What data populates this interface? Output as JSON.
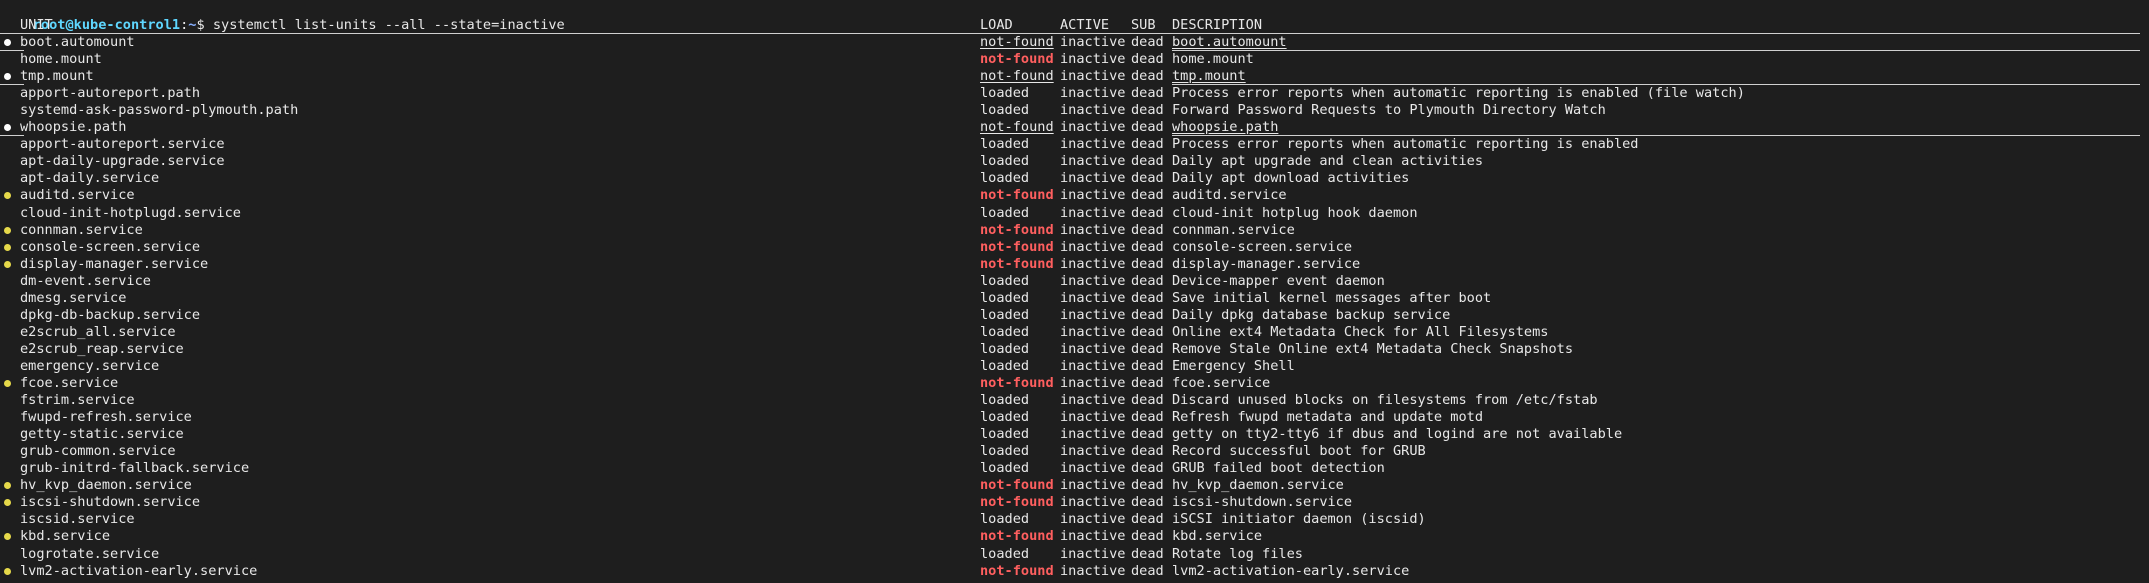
{
  "prompt": {
    "user_host": "root@kube-control1",
    "path": "~",
    "symbol": "$",
    "command": "systemctl list-units --all --state=inactive"
  },
  "header": {
    "unit": "UNIT",
    "load": "LOAD",
    "active": "ACTIVE",
    "sub": "SUB",
    "description": "DESCRIPTION"
  },
  "rows": [
    {
      "bullet": "white",
      "unit": "boot.automount",
      "load": "not-found",
      "active": "inactive",
      "sub": "dead",
      "desc": "boot.automount",
      "style": "ul"
    },
    {
      "bullet": "",
      "unit": "home.mount",
      "load": "not-found",
      "active": "inactive",
      "sub": "dead",
      "desc": "home.mount",
      "style": "red"
    },
    {
      "bullet": "white",
      "unit": "tmp.mount",
      "load": "not-found",
      "active": "inactive",
      "sub": "dead",
      "desc": "tmp.mount",
      "style": "ul"
    },
    {
      "bullet": "",
      "unit": "apport-autoreport.path",
      "load": "loaded",
      "active": "inactive",
      "sub": "dead",
      "desc": "Process error reports when automatic reporting is enabled (file watch)",
      "style": ""
    },
    {
      "bullet": "",
      "unit": "systemd-ask-password-plymouth.path",
      "load": "loaded",
      "active": "inactive",
      "sub": "dead",
      "desc": "Forward Password Requests to Plymouth Directory Watch",
      "style": ""
    },
    {
      "bullet": "white",
      "unit": "whoopsie.path",
      "load": "not-found",
      "active": "inactive",
      "sub": "dead",
      "desc": "whoopsie.path",
      "style": "ul"
    },
    {
      "bullet": "",
      "unit": "apport-autoreport.service",
      "load": "loaded",
      "active": "inactive",
      "sub": "dead",
      "desc": "Process error reports when automatic reporting is enabled",
      "style": ""
    },
    {
      "bullet": "",
      "unit": "apt-daily-upgrade.service",
      "load": "loaded",
      "active": "inactive",
      "sub": "dead",
      "desc": "Daily apt upgrade and clean activities",
      "style": ""
    },
    {
      "bullet": "",
      "unit": "apt-daily.service",
      "load": "loaded",
      "active": "inactive",
      "sub": "dead",
      "desc": "Daily apt download activities",
      "style": ""
    },
    {
      "bullet": "yellow",
      "unit": "auditd.service",
      "load": "not-found",
      "active": "inactive",
      "sub": "dead",
      "desc": "auditd.service",
      "style": "red"
    },
    {
      "bullet": "",
      "unit": "cloud-init-hotplugd.service",
      "load": "loaded",
      "active": "inactive",
      "sub": "dead",
      "desc": "cloud-init hotplug hook daemon",
      "style": ""
    },
    {
      "bullet": "yellow",
      "unit": "connman.service",
      "load": "not-found",
      "active": "inactive",
      "sub": "dead",
      "desc": "connman.service",
      "style": "red"
    },
    {
      "bullet": "yellow",
      "unit": "console-screen.service",
      "load": "not-found",
      "active": "inactive",
      "sub": "dead",
      "desc": "console-screen.service",
      "style": "red"
    },
    {
      "bullet": "yellow",
      "unit": "display-manager.service",
      "load": "not-found",
      "active": "inactive",
      "sub": "dead",
      "desc": "display-manager.service",
      "style": "red"
    },
    {
      "bullet": "",
      "unit": "dm-event.service",
      "load": "loaded",
      "active": "inactive",
      "sub": "dead",
      "desc": "Device-mapper event daemon",
      "style": ""
    },
    {
      "bullet": "",
      "unit": "dmesg.service",
      "load": "loaded",
      "active": "inactive",
      "sub": "dead",
      "desc": "Save initial kernel messages after boot",
      "style": ""
    },
    {
      "bullet": "",
      "unit": "dpkg-db-backup.service",
      "load": "loaded",
      "active": "inactive",
      "sub": "dead",
      "desc": "Daily dpkg database backup service",
      "style": ""
    },
    {
      "bullet": "",
      "unit": "e2scrub_all.service",
      "load": "loaded",
      "active": "inactive",
      "sub": "dead",
      "desc": "Online ext4 Metadata Check for All Filesystems",
      "style": ""
    },
    {
      "bullet": "",
      "unit": "e2scrub_reap.service",
      "load": "loaded",
      "active": "inactive",
      "sub": "dead",
      "desc": "Remove Stale Online ext4 Metadata Check Snapshots",
      "style": ""
    },
    {
      "bullet": "",
      "unit": "emergency.service",
      "load": "loaded",
      "active": "inactive",
      "sub": "dead",
      "desc": "Emergency Shell",
      "style": ""
    },
    {
      "bullet": "yellow",
      "unit": "fcoe.service",
      "load": "not-found",
      "active": "inactive",
      "sub": "dead",
      "desc": "fcoe.service",
      "style": "red"
    },
    {
      "bullet": "",
      "unit": "fstrim.service",
      "load": "loaded",
      "active": "inactive",
      "sub": "dead",
      "desc": "Discard unused blocks on filesystems from /etc/fstab",
      "style": ""
    },
    {
      "bullet": "",
      "unit": "fwupd-refresh.service",
      "load": "loaded",
      "active": "inactive",
      "sub": "dead",
      "desc": "Refresh fwupd metadata and update motd",
      "style": ""
    },
    {
      "bullet": "",
      "unit": "getty-static.service",
      "load": "loaded",
      "active": "inactive",
      "sub": "dead",
      "desc": "getty on tty2-tty6 if dbus and logind are not available",
      "style": ""
    },
    {
      "bullet": "",
      "unit": "grub-common.service",
      "load": "loaded",
      "active": "inactive",
      "sub": "dead",
      "desc": "Record successful boot for GRUB",
      "style": ""
    },
    {
      "bullet": "",
      "unit": "grub-initrd-fallback.service",
      "load": "loaded",
      "active": "inactive",
      "sub": "dead",
      "desc": "GRUB failed boot detection",
      "style": ""
    },
    {
      "bullet": "yellow",
      "unit": "hv_kvp_daemon.service",
      "load": "not-found",
      "active": "inactive",
      "sub": "dead",
      "desc": "hv_kvp_daemon.service",
      "style": "red"
    },
    {
      "bullet": "yellow",
      "unit": "iscsi-shutdown.service",
      "load": "not-found",
      "active": "inactive",
      "sub": "dead",
      "desc": "iscsi-shutdown.service",
      "style": "red"
    },
    {
      "bullet": "",
      "unit": "iscsid.service",
      "load": "loaded",
      "active": "inactive",
      "sub": "dead",
      "desc": "iSCSI initiator daemon (iscsid)",
      "style": ""
    },
    {
      "bullet": "yellow",
      "unit": "kbd.service",
      "load": "not-found",
      "active": "inactive",
      "sub": "dead",
      "desc": "kbd.service",
      "style": "red"
    },
    {
      "bullet": "",
      "unit": "logrotate.service",
      "load": "loaded",
      "active": "inactive",
      "sub": "dead",
      "desc": "Rotate log files",
      "style": ""
    },
    {
      "bullet": "yellow",
      "unit": "lvm2-activation-early.service",
      "load": "not-found",
      "active": "inactive",
      "sub": "dead",
      "desc": "lvm2-activation-early.service",
      "style": "red"
    }
  ]
}
